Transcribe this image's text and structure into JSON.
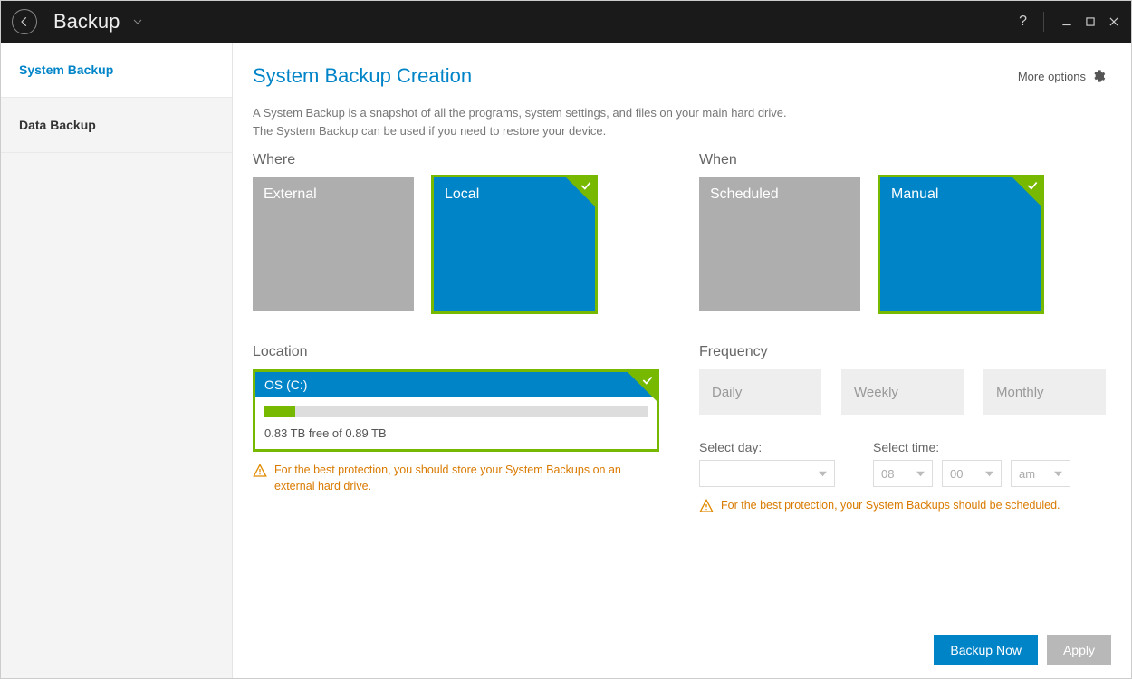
{
  "titlebar": {
    "title": "Backup"
  },
  "sidebar": {
    "items": [
      {
        "label": "System Backup",
        "active": true
      },
      {
        "label": "Data Backup",
        "active": false
      }
    ]
  },
  "header": {
    "title": "System Backup Creation",
    "more_options": "More options"
  },
  "description": {
    "line1": "A System Backup is a snapshot of all the programs, system settings, and files on your main hard drive.",
    "line2": "The System Backup can be used if you need to restore your device."
  },
  "where": {
    "label": "Where",
    "options": [
      {
        "label": "External",
        "selected": false
      },
      {
        "label": "Local",
        "selected": true
      }
    ]
  },
  "when": {
    "label": "When",
    "options": [
      {
        "label": "Scheduled",
        "selected": false
      },
      {
        "label": "Manual",
        "selected": true
      }
    ]
  },
  "location": {
    "label": "Location",
    "drive_name": "OS (C:)",
    "free_text": "0.83 TB free of 0.89 TB",
    "used_percent": 8,
    "warning": "For the best protection, you should store your System Backups on an external hard drive."
  },
  "frequency": {
    "label": "Frequency",
    "options": [
      "Daily",
      "Weekly",
      "Monthly"
    ],
    "select_day_label": "Select day:",
    "select_time_label": "Select time:",
    "day_value": "",
    "hour_value": "08",
    "minute_value": "00",
    "ampm_value": "am",
    "warning": "For the best protection, your System Backups should be scheduled."
  },
  "footer": {
    "backup_now": "Backup Now",
    "apply": "Apply"
  }
}
